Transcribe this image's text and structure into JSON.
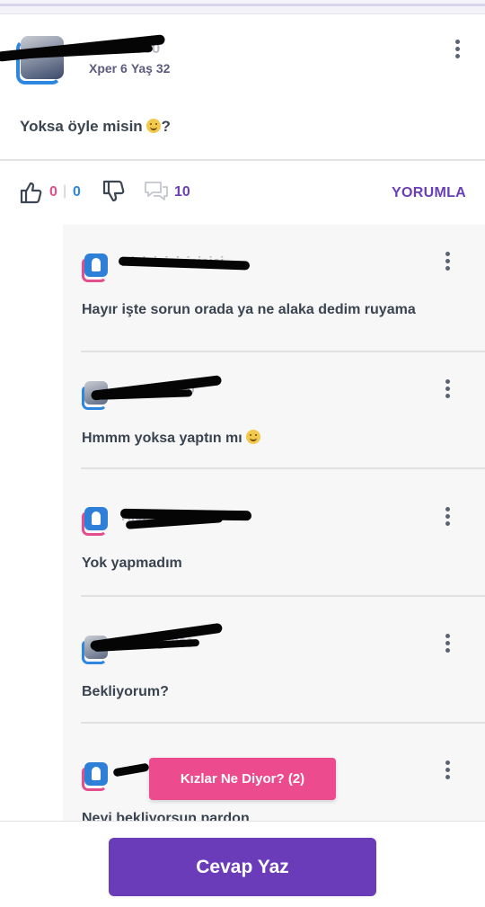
{
  "post": {
    "author_meta": {
      "xper": "Xper 6",
      "age": "Yaş 32"
    },
    "text": "Yoksa öyle misin",
    "text_suffix": "?",
    "likes": "0",
    "dislikes": "0",
    "comments": "10",
    "comment_action": "YORUMLA"
  },
  "replies": [
    {
      "text": "Hayır işte sorun orada ya ne alaka dedim ruyama",
      "avatar": "badge"
    },
    {
      "text": "Hmmm yoksa yaptın mı",
      "avatar": "photo",
      "emoji": "smiley"
    },
    {
      "text": "Yok yapmadım",
      "avatar": "badge"
    },
    {
      "text": "Bekliyorum?",
      "avatar": "photo"
    },
    {
      "text": "Neyi bekliyorsun pardon",
      "avatar": "badge"
    }
  ],
  "floating_button": "Kızlar Ne Diyor? (2)",
  "primary_action": "Cevap Yaz",
  "colors": {
    "accent_purple": "#6a3cba",
    "accent_pink": "#ec4c8d",
    "like_count": "#e44e8a",
    "dislike_count": "#2d86e0"
  },
  "icons": [
    "thumbs-up-icon",
    "thumbs-down-icon",
    "comments-icon",
    "more-vertical-icon",
    "expert-badge-icon"
  ]
}
